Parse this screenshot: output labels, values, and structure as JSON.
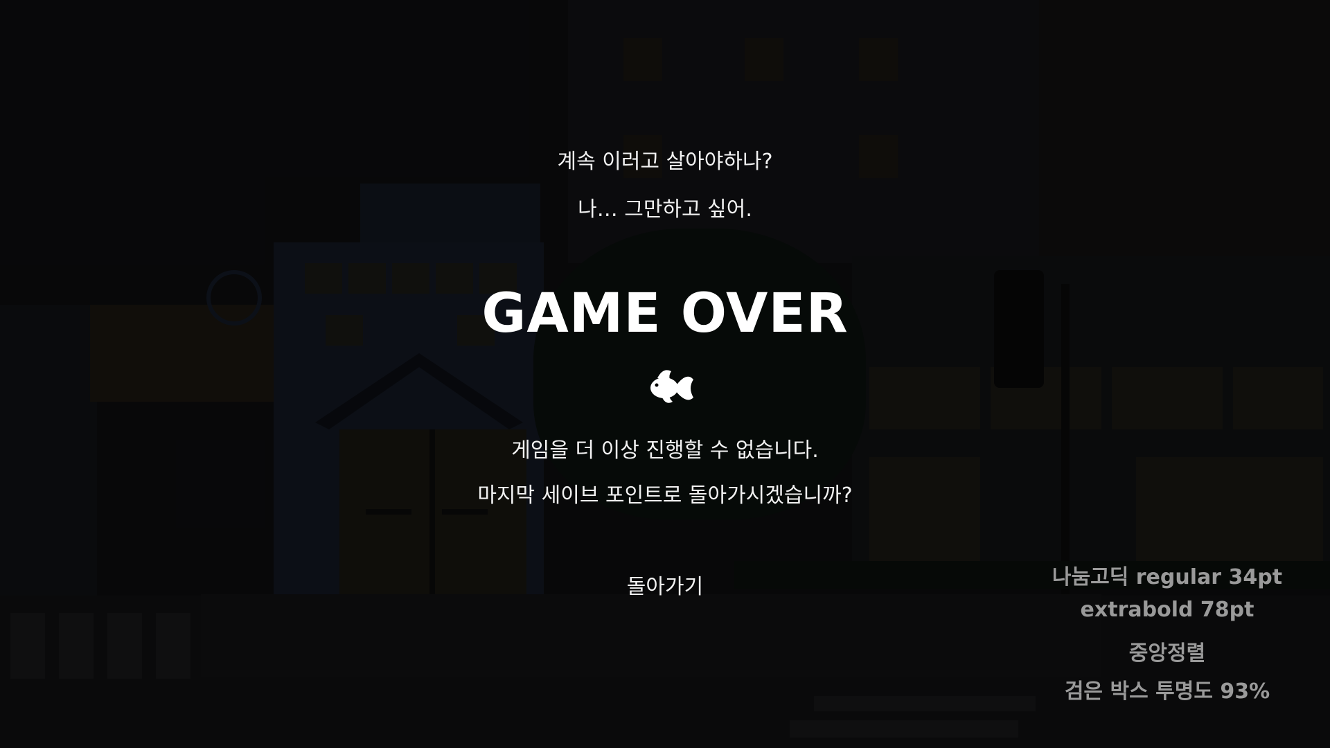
{
  "dialog": {
    "line1": "계속 이러고 살아야하나?",
    "line2": "나… 그만하고 싶어.",
    "title": "GAME OVER",
    "icon": "fish-icon",
    "message1": "게임을 더 이상 진행할 수 없습니다.",
    "message2": "마지막 세이브 포인트로 돌아가시겠습니까?",
    "return_label": "돌아가기"
  },
  "notes": {
    "note1": "나눔고딕 regular 34pt",
    "note2": "extrabold 78pt",
    "note3": "중앙정렬",
    "note4": "검은 박스 투명도 93%"
  },
  "colors": {
    "text": "#f2f2f2",
    "note_text": "#9a9a9a",
    "overlay": "#000000"
  }
}
